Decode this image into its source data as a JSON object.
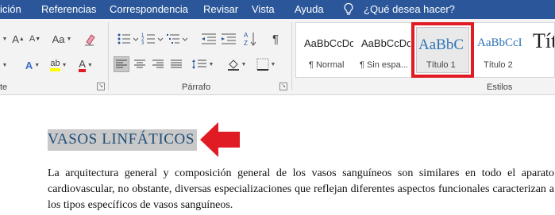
{
  "menubar": {
    "tabs": [
      "ición",
      "Referencias",
      "Correspondencia",
      "Revisar",
      "Vista",
      "Ayuda"
    ],
    "tell_me": "¿Qué desea hacer?",
    "background": "#2b579a"
  },
  "ribbon": {
    "font_group": {
      "label": "te",
      "font_size_grow": "A",
      "font_size_shrink": "A",
      "change_case": "Aa",
      "text_effects": "A",
      "highlight": "ab",
      "font_color": "A"
    },
    "paragraph_group": {
      "label": "Párrafo",
      "pilcrow": "¶"
    },
    "styles_group": {
      "label": "Estilos",
      "items": [
        {
          "sample": "AaBbCcDc",
          "name": "¶ Normal"
        },
        {
          "sample": "AaBbCcDc",
          "name": "¶ Sin espa..."
        },
        {
          "sample": "AaBbC",
          "name": "Título 1"
        },
        {
          "sample": "AaBbCcI",
          "name": "Título 2"
        },
        {
          "sample": "Tít",
          "name": ""
        }
      ],
      "selected": "Título 1"
    }
  },
  "document": {
    "heading": "VASOS LINFÁTICOS",
    "paragraph": "La arquitectura general y composición general de los vasos sanguíneos son similares en todo el aparato cardiovascular, no obstante, diversas especializaciones que reflejan diferentes aspectos funcionales caracterizan a los tipos específicos de vasos sanguíneos."
  },
  "colors": {
    "accent": "#2b579a",
    "annotation_red": "#e01b24",
    "heading_text": "#1f4e79",
    "selection": "#c9c9c9"
  }
}
